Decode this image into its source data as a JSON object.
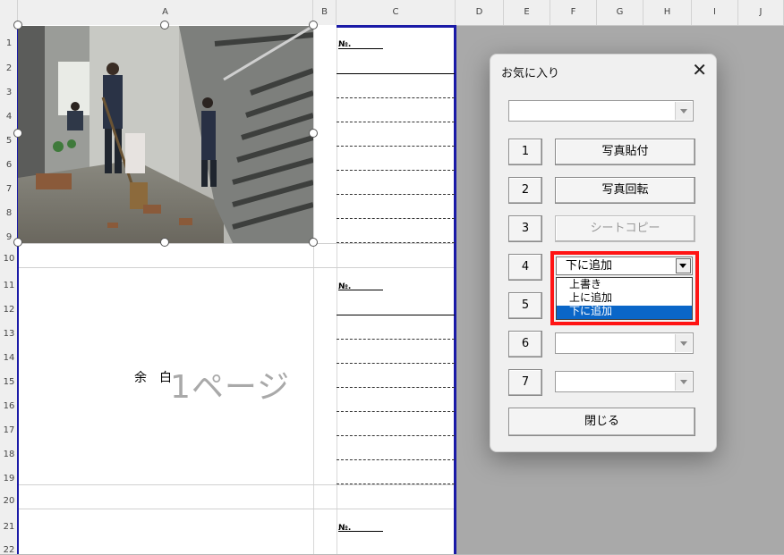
{
  "columns": [
    "A",
    "B",
    "C",
    "D",
    "E",
    "F",
    "G",
    "H",
    "I",
    "J"
  ],
  "rows": [
    "1",
    "2",
    "3",
    "4",
    "5",
    "6",
    "7",
    "8",
    "9",
    "10",
    "11",
    "12",
    "13",
    "14",
    "15",
    "16",
    "17",
    "18",
    "19",
    "20",
    "21",
    "22"
  ],
  "sheet": {
    "no_label": "№.",
    "margin_label": "余　白",
    "watermark": "1ページ"
  },
  "dialog": {
    "title": "お気に入り",
    "close_glyph": "✕",
    "top_combo_value": "",
    "buttons": [
      {
        "num": "1",
        "label": "写真貼付",
        "enabled": true
      },
      {
        "num": "2",
        "label": "写真回転",
        "enabled": true
      },
      {
        "num": "3",
        "label": "シートコピー",
        "enabled": false
      }
    ],
    "row4": {
      "num": "4",
      "dropdown_value": "下に追加",
      "options": [
        "上書き",
        "上に追加",
        "下に追加"
      ],
      "selected_index": 2
    },
    "row5_num": "5",
    "row6_num": "6",
    "row7_num": "7",
    "close_button": "閉じる"
  },
  "colors": {
    "page_border": "#1a1aa6",
    "highlight": "#ff1414",
    "selection": "#0a66c8"
  }
}
